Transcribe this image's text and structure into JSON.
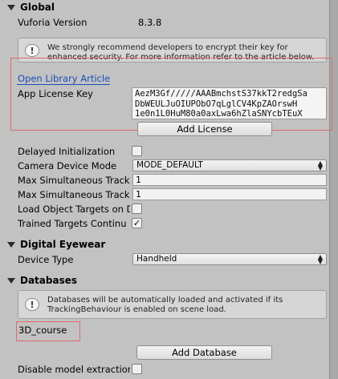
{
  "sections": {
    "global": "Global",
    "digital_eyewear": "Digital Eyewear",
    "databases": "Databases"
  },
  "global": {
    "vuforia_version_label": "Vuforia Version",
    "vuforia_version_value": "8.3.8",
    "help_text": "We strongly recommend developers to encrypt their key for enhanced security. For more information refer to the article below.",
    "open_library_article": "Open Library Article",
    "app_license_key_label": "App License Key",
    "app_license_key_lines": [
      "AezM3Gf/////AAABmchstS37kkT2redgSa",
      "DbWEULJuOIUPObO7qLglCV4KpZAOrswH",
      "1e0n1L0HuM80a0axLwa6hZlaSNYcbTEuX"
    ],
    "add_license_button": "Add License",
    "delayed_initialization_label": "Delayed Initialization",
    "delayed_initialization_checked": false,
    "camera_device_mode_label": "Camera Device Mode",
    "camera_device_mode_value": "MODE_DEFAULT",
    "max_sim_1_label": "Max Simultaneous Track",
    "max_sim_1_value": "1",
    "max_sim_2_label": "Max Simultaneous Track",
    "max_sim_2_value": "1",
    "load_object_targets_label": "Load Object Targets on D",
    "load_object_targets_checked": false,
    "trained_targets_label": "Trained Targets Continu",
    "trained_targets_checked": true
  },
  "digital_eyewear": {
    "device_type_label": "Device Type",
    "device_type_value": "Handheld"
  },
  "databases": {
    "help_text": "Databases will be automatically loaded and activated if its TrackingBehaviour is enabled on scene load.",
    "database_item": "3D_course",
    "add_database_button": "Add Database",
    "disable_model_extraction_label": "Disable model extraction",
    "disable_model_extraction_checked": false
  },
  "icons": {
    "info": "info-icon",
    "foldout": "foldout-arrow-icon",
    "dropdown": "dropdown-arrow-icon",
    "check": "checkmark-icon"
  },
  "colors": {
    "background": "#c2c2c2",
    "highlight_box": "#e06a6a",
    "link": "#1a4fb8"
  }
}
